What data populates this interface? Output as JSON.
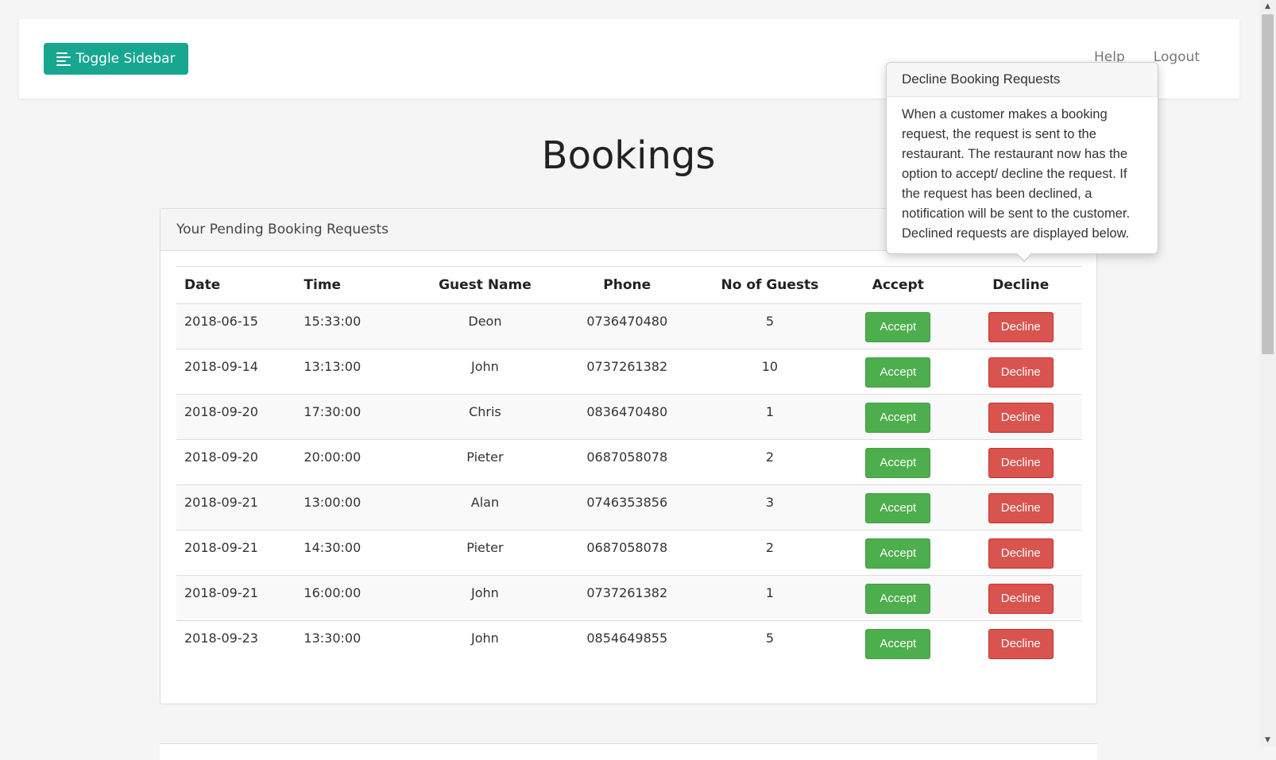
{
  "topbar": {
    "toggle_label": "Toggle Sidebar",
    "nav": [
      "Help",
      "Logout"
    ]
  },
  "page": {
    "title": "Bookings"
  },
  "pending": {
    "header": "Your Pending Booking Requests",
    "columns": [
      "Date",
      "Time",
      "Guest Name",
      "Phone",
      "No of Guests",
      "Accept",
      "Decline"
    ],
    "accept_label": "Accept",
    "decline_label": "Decline",
    "rows": [
      {
        "date": "2018-06-15",
        "time": "15:33:00",
        "name": "Deon",
        "phone": "0736470480",
        "guests": "5"
      },
      {
        "date": "2018-09-14",
        "time": "13:13:00",
        "name": "John",
        "phone": "0737261382",
        "guests": "10"
      },
      {
        "date": "2018-09-20",
        "time": "17:30:00",
        "name": "Chris",
        "phone": "0836470480",
        "guests": "1"
      },
      {
        "date": "2018-09-20",
        "time": "20:00:00",
        "name": "Pieter",
        "phone": "0687058078",
        "guests": "2"
      },
      {
        "date": "2018-09-21",
        "time": "13:00:00",
        "name": "Alan",
        "phone": "0746353856",
        "guests": "3"
      },
      {
        "date": "2018-09-21",
        "time": "14:30:00",
        "name": "Pieter",
        "phone": "0687058078",
        "guests": "2"
      },
      {
        "date": "2018-09-21",
        "time": "16:00:00",
        "name": "John",
        "phone": "0737261382",
        "guests": "1"
      },
      {
        "date": "2018-09-23",
        "time": "13:30:00",
        "name": "John",
        "phone": "0854649855",
        "guests": "5"
      }
    ]
  },
  "popover": {
    "title": "Decline Booking Requests",
    "lines": [
      "When a customer makes a booking",
      "request, the request is sent to the",
      "restaurant. The restaurant now has the",
      "option to accept/ decline the request. If",
      "the request has been declined, a",
      "notification will be sent to the customer.",
      "Declined requests are displayed below."
    ]
  },
  "colors": {
    "brand": "#17a690",
    "accept": "#4cae4c",
    "decline": "#d9534f"
  },
  "icons": {
    "toggle": "menu-lines-icon",
    "scroll_up": "triangle-up-icon",
    "scroll_down": "triangle-down-icon"
  }
}
